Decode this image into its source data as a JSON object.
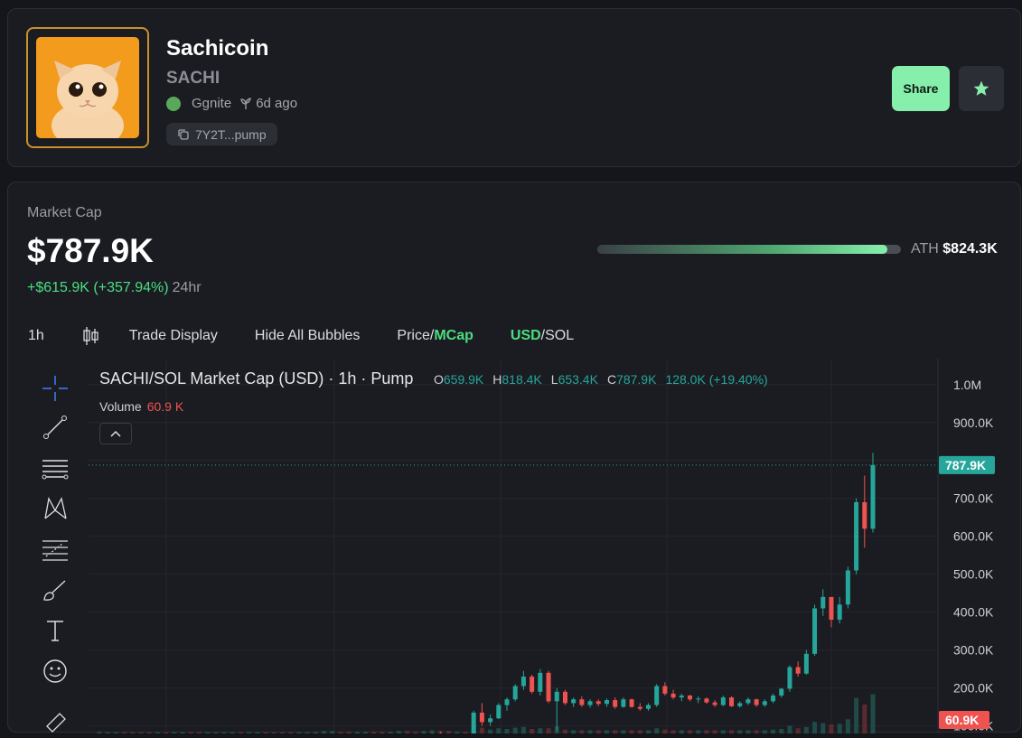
{
  "token": {
    "name": "Sachicoin",
    "ticker": "SACHI",
    "creator": "Ggnite",
    "age": "6d ago",
    "address": "7Y2T...pump"
  },
  "actions": {
    "share_label": "Share",
    "favorite_icon": "star-icon"
  },
  "market": {
    "label": "Market Cap",
    "value": "$787.9K",
    "change": "+$615.9K (+357.94%)",
    "change_period": "24hr",
    "ath_label": "ATH",
    "ath_value": "$824.3K",
    "ath_progress": 0.956
  },
  "toolbar": {
    "interval": "1h",
    "trade_display": "Trade Display",
    "hide_bubbles": "Hide All Bubbles",
    "price_label": "Price/",
    "mcap_label": "MCap",
    "usd_label": "USD",
    "sol_label": "/SOL"
  },
  "chart": {
    "legend": "SACHI/SOL Market Cap (USD) · 1h · Pump",
    "ohlc": {
      "o_label": "O",
      "o": "659.9K",
      "h_label": "H",
      "h": "818.4K",
      "l_label": "L",
      "l": "653.4K",
      "c_label": "C",
      "c": "787.9K",
      "change": "128.0K (+19.40%)"
    },
    "volume_label": "Volume",
    "volume_value": "60.9 K",
    "last_price_tag": "787.9K",
    "volume_tag": "60.9K"
  },
  "chart_data": {
    "type": "candlestick",
    "y_ticks": [
      "1.0M",
      "900.0K",
      "800.0K",
      "700.0K",
      "600.0K",
      "500.0K",
      "400.0K",
      "300.0K",
      "200.0K",
      "100.0K"
    ],
    "ylim": [
      80000,
      1040000
    ],
    "last_value": 787900,
    "candles": [
      [
        38,
        40,
        36,
        39
      ],
      [
        39,
        42,
        38,
        41
      ],
      [
        41,
        50,
        40,
        48
      ],
      [
        48,
        52,
        45,
        46
      ],
      [
        46,
        47,
        38,
        40
      ],
      [
        40,
        41,
        35,
        36
      ],
      [
        36,
        37,
        30,
        32
      ],
      [
        32,
        34,
        29,
        33
      ],
      [
        33,
        34,
        30,
        31
      ],
      [
        31,
        33,
        30,
        32
      ],
      [
        32,
        34,
        31,
        33
      ],
      [
        33,
        35,
        31,
        32
      ],
      [
        32,
        33,
        29,
        30
      ],
      [
        30,
        32,
        29,
        31
      ],
      [
        31,
        33,
        30,
        32
      ],
      [
        32,
        34,
        31,
        33
      ],
      [
        33,
        35,
        32,
        34
      ],
      [
        34,
        35,
        31,
        32
      ],
      [
        32,
        34,
        30,
        33
      ],
      [
        33,
        36,
        32,
        35
      ],
      [
        35,
        37,
        33,
        34
      ],
      [
        34,
        35,
        32,
        33
      ],
      [
        33,
        34,
        31,
        32
      ],
      [
        32,
        33,
        30,
        31
      ],
      [
        31,
        33,
        30,
        32
      ],
      [
        32,
        36,
        31,
        35
      ],
      [
        35,
        42,
        34,
        40
      ],
      [
        40,
        55,
        38,
        52
      ],
      [
        52,
        62,
        50,
        60
      ],
      [
        60,
        62,
        54,
        56
      ],
      [
        56,
        58,
        50,
        52
      ],
      [
        52,
        55,
        49,
        53
      ],
      [
        53,
        58,
        52,
        57
      ],
      [
        57,
        60,
        54,
        55
      ],
      [
        55,
        57,
        50,
        52
      ],
      [
        52,
        56,
        51,
        55
      ],
      [
        55,
        62,
        54,
        60
      ],
      [
        60,
        64,
        57,
        58
      ],
      [
        58,
        60,
        55,
        57
      ],
      [
        57,
        70,
        56,
        68
      ],
      [
        68,
        82,
        66,
        80
      ],
      [
        80,
        85,
        76,
        78
      ],
      [
        78,
        80,
        60,
        62
      ],
      [
        62,
        66,
        55,
        64
      ],
      [
        64,
        68,
        60,
        62
      ],
      [
        62,
        140,
        60,
        135
      ],
      [
        135,
        160,
        100,
        110
      ],
      [
        110,
        130,
        100,
        120
      ],
      [
        120,
        160,
        118,
        155
      ],
      [
        155,
        175,
        140,
        170
      ],
      [
        170,
        210,
        165,
        205
      ],
      [
        205,
        245,
        195,
        230
      ],
      [
        230,
        235,
        185,
        190
      ],
      [
        190,
        250,
        180,
        240
      ],
      [
        240,
        245,
        160,
        165
      ],
      [
        165,
        200,
        85,
        190
      ],
      [
        190,
        195,
        155,
        160
      ],
      [
        160,
        175,
        150,
        170
      ],
      [
        170,
        178,
        150,
        155
      ],
      [
        155,
        170,
        148,
        165
      ],
      [
        165,
        170,
        152,
        158
      ],
      [
        158,
        172,
        150,
        168
      ],
      [
        168,
        175,
        145,
        150
      ],
      [
        150,
        175,
        148,
        170
      ],
      [
        170,
        172,
        148,
        150
      ],
      [
        150,
        160,
        140,
        145
      ],
      [
        145,
        160,
        140,
        155
      ],
      [
        155,
        210,
        150,
        205
      ],
      [
        205,
        215,
        180,
        185
      ],
      [
        185,
        195,
        170,
        175
      ],
      [
        175,
        185,
        165,
        180
      ],
      [
        180,
        182,
        165,
        170
      ],
      [
        170,
        178,
        160,
        172
      ],
      [
        172,
        175,
        158,
        162
      ],
      [
        162,
        168,
        150,
        155
      ],
      [
        155,
        180,
        152,
        175
      ],
      [
        175,
        178,
        150,
        152
      ],
      [
        152,
        165,
        148,
        160
      ],
      [
        160,
        175,
        155,
        170
      ],
      [
        170,
        172,
        150,
        155
      ],
      [
        155,
        170,
        150,
        165
      ],
      [
        165,
        185,
        160,
        180
      ],
      [
        180,
        200,
        175,
        198
      ],
      [
        198,
        260,
        190,
        255
      ],
      [
        255,
        270,
        230,
        238
      ],
      [
        238,
        300,
        235,
        290
      ],
      [
        290,
        420,
        285,
        410
      ],
      [
        410,
        460,
        390,
        440
      ],
      [
        440,
        395,
        360,
        380
      ],
      [
        380,
        440,
        370,
        420
      ],
      [
        420,
        520,
        410,
        510
      ],
      [
        510,
        700,
        500,
        690
      ],
      [
        690,
        760,
        570,
        620
      ],
      [
        620,
        820,
        610,
        788
      ]
    ],
    "volume": [
      3,
      2,
      2,
      2,
      2,
      2,
      2,
      2,
      2,
      2,
      2,
      2,
      2,
      2,
      2,
      2,
      2,
      2,
      2,
      2,
      2,
      2,
      2,
      2,
      2,
      2,
      3,
      4,
      4,
      3,
      3,
      3,
      3,
      3,
      3,
      3,
      4,
      4,
      3,
      4,
      5,
      4,
      4,
      3,
      3,
      12,
      9,
      6,
      8,
      7,
      9,
      10,
      7,
      8,
      8,
      11,
      6,
      5,
      5,
      5,
      5,
      5,
      5,
      5,
      5,
      5,
      5,
      8,
      6,
      5,
      5,
      5,
      5,
      5,
      5,
      5,
      5,
      5,
      5,
      5,
      5,
      6,
      7,
      12,
      8,
      10,
      18,
      16,
      14,
      15,
      22,
      55,
      45,
      60.9
    ]
  }
}
